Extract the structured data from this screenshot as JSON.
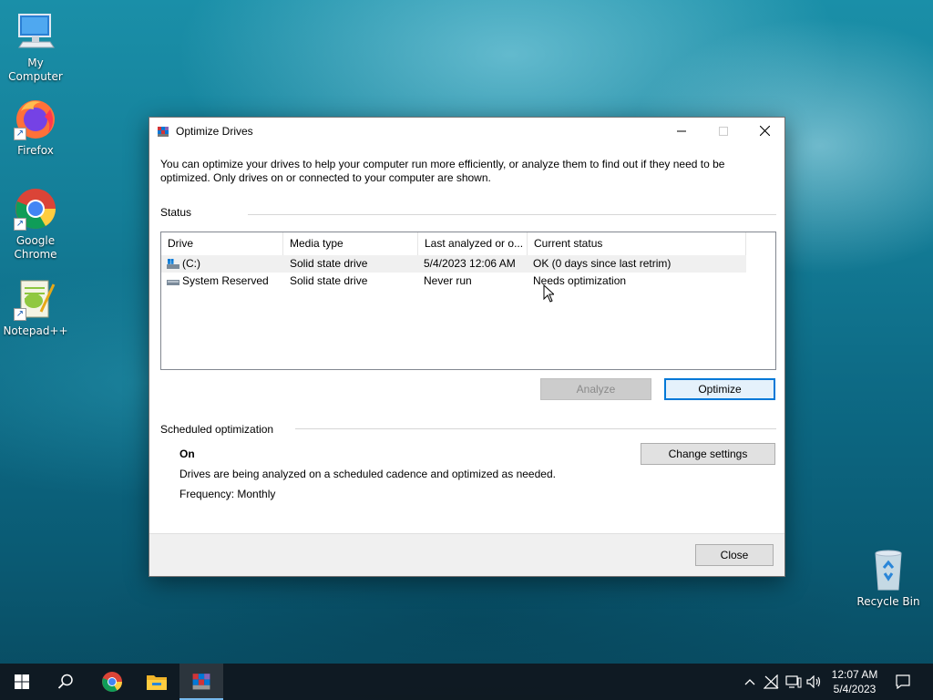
{
  "desktop": {
    "icons": [
      {
        "label": "My Computer",
        "icon": "computer-icon"
      },
      {
        "label": "Firefox",
        "icon": "firefox-icon"
      },
      {
        "label": "Google\nChrome",
        "line1": "Google",
        "line2": "Chrome",
        "icon": "chrome-icon"
      },
      {
        "label": "Notepad++",
        "icon": "notepadpp-icon"
      },
      {
        "label": "Recycle Bin",
        "icon": "recycle-bin-icon"
      }
    ]
  },
  "window": {
    "title": "Optimize Drives",
    "description": "You can optimize your drives to help your computer run more efficiently, or analyze them to find out if they need to be optimized. Only drives on or connected to your computer are shown.",
    "status_label": "Status",
    "columns": [
      "Drive",
      "Media type",
      "Last analyzed or o...",
      "Current status"
    ],
    "drives": [
      {
        "drive": "(C:)",
        "media_type": "Solid state drive",
        "last_analyzed": "5/4/2023 12:06 AM",
        "status": "OK (0 days since last retrim)",
        "selected": true,
        "icon": "windows-drive-icon"
      },
      {
        "drive": "System Reserved",
        "media_type": "Solid state drive",
        "last_analyzed": "Never run",
        "status": "Needs optimization",
        "selected": false,
        "icon": "drive-icon"
      }
    ],
    "analyze_label": "Analyze",
    "optimize_label": "Optimize",
    "scheduled_label": "Scheduled optimization",
    "schedule_state": "On",
    "schedule_desc": "Drives are being analyzed on a scheduled cadence and optimized as needed.",
    "frequency": "Frequency: Monthly",
    "change_settings_label": "Change settings",
    "close_label": "Close"
  },
  "taskbar": {
    "time": "12:07 AM",
    "date": "5/4/2023",
    "pinned": [
      "start-icon",
      "search-icon",
      "chrome-icon",
      "file-explorer-icon",
      "defrag-icon"
    ],
    "active": "defrag-icon"
  },
  "colors": {
    "accent": "#0078d7",
    "taskbar": "#101820",
    "desktop": "#147e98"
  }
}
